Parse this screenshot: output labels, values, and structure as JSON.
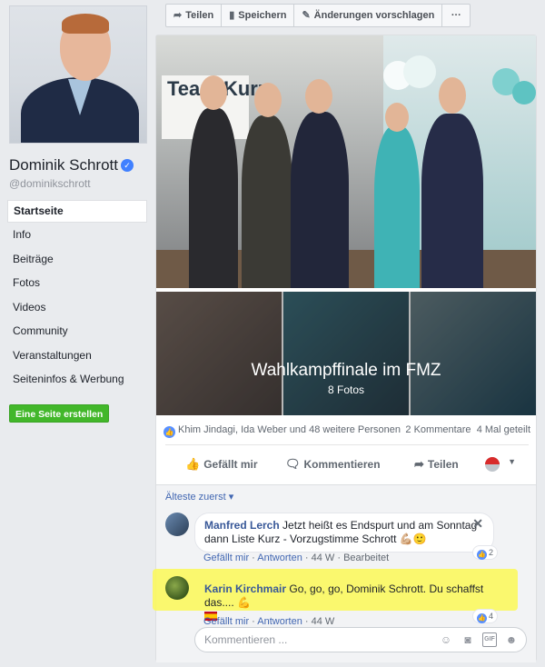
{
  "page": {
    "name": "Dominik Schrott",
    "handle": "@dominikschrott",
    "verified_icon": "verified-check-icon"
  },
  "sidebar": {
    "items": [
      {
        "label": "Startseite",
        "active": true
      },
      {
        "label": "Info"
      },
      {
        "label": "Beiträge"
      },
      {
        "label": "Fotos"
      },
      {
        "label": "Videos"
      },
      {
        "label": "Community"
      },
      {
        "label": "Veranstaltungen"
      },
      {
        "label": "Seiteninfos & Werbung"
      }
    ],
    "create_page": "Eine Seite erstellen"
  },
  "actionbar": {
    "share": "Teilen",
    "save": "Speichern",
    "suggest_edits": "Änderungen vorschlagen",
    "more": "···"
  },
  "post": {
    "photo_banner_text": "Team Kurz",
    "album_title": "Wahlkampffinale im FMZ",
    "album_count": "8 Fotos",
    "reactions_text": "Khim Jindagi, Ida Weber und 48 weitere Personen",
    "comments_count": "2 Kommentare",
    "shares_count": "4 Mal geteilt",
    "actions": {
      "like": "Gefällt mir",
      "comment": "Kommentieren",
      "share": "Teilen"
    },
    "sort_label": "Älteste zuerst"
  },
  "comments": [
    {
      "author": "Manfred Lerch",
      "text": "Jetzt heißt es Endspurt und am Sonntag dann Liste Kurz - Vorzugstimme Schrott",
      "like": "Gefällt mir",
      "reply": "Antworten",
      "time": "44 W",
      "edited": "Bearbeitet",
      "likes": "2"
    },
    {
      "author": "Karin Kirchmair",
      "text": "Go, go, go, Dominik Schrott. Du schaffst das....",
      "like": "Gefällt mir",
      "reply": "Antworten",
      "time": "44 W",
      "likes": "4"
    }
  ],
  "composer": {
    "placeholder": "Kommentieren ...",
    "icons": [
      "emoji-icon",
      "camera-icon",
      "gif-icon",
      "sticker-icon"
    ]
  },
  "colors": {
    "link": "#385898",
    "green_button": "#42b72a",
    "highlight": "#fbf85b",
    "verified": "#4080ff"
  }
}
